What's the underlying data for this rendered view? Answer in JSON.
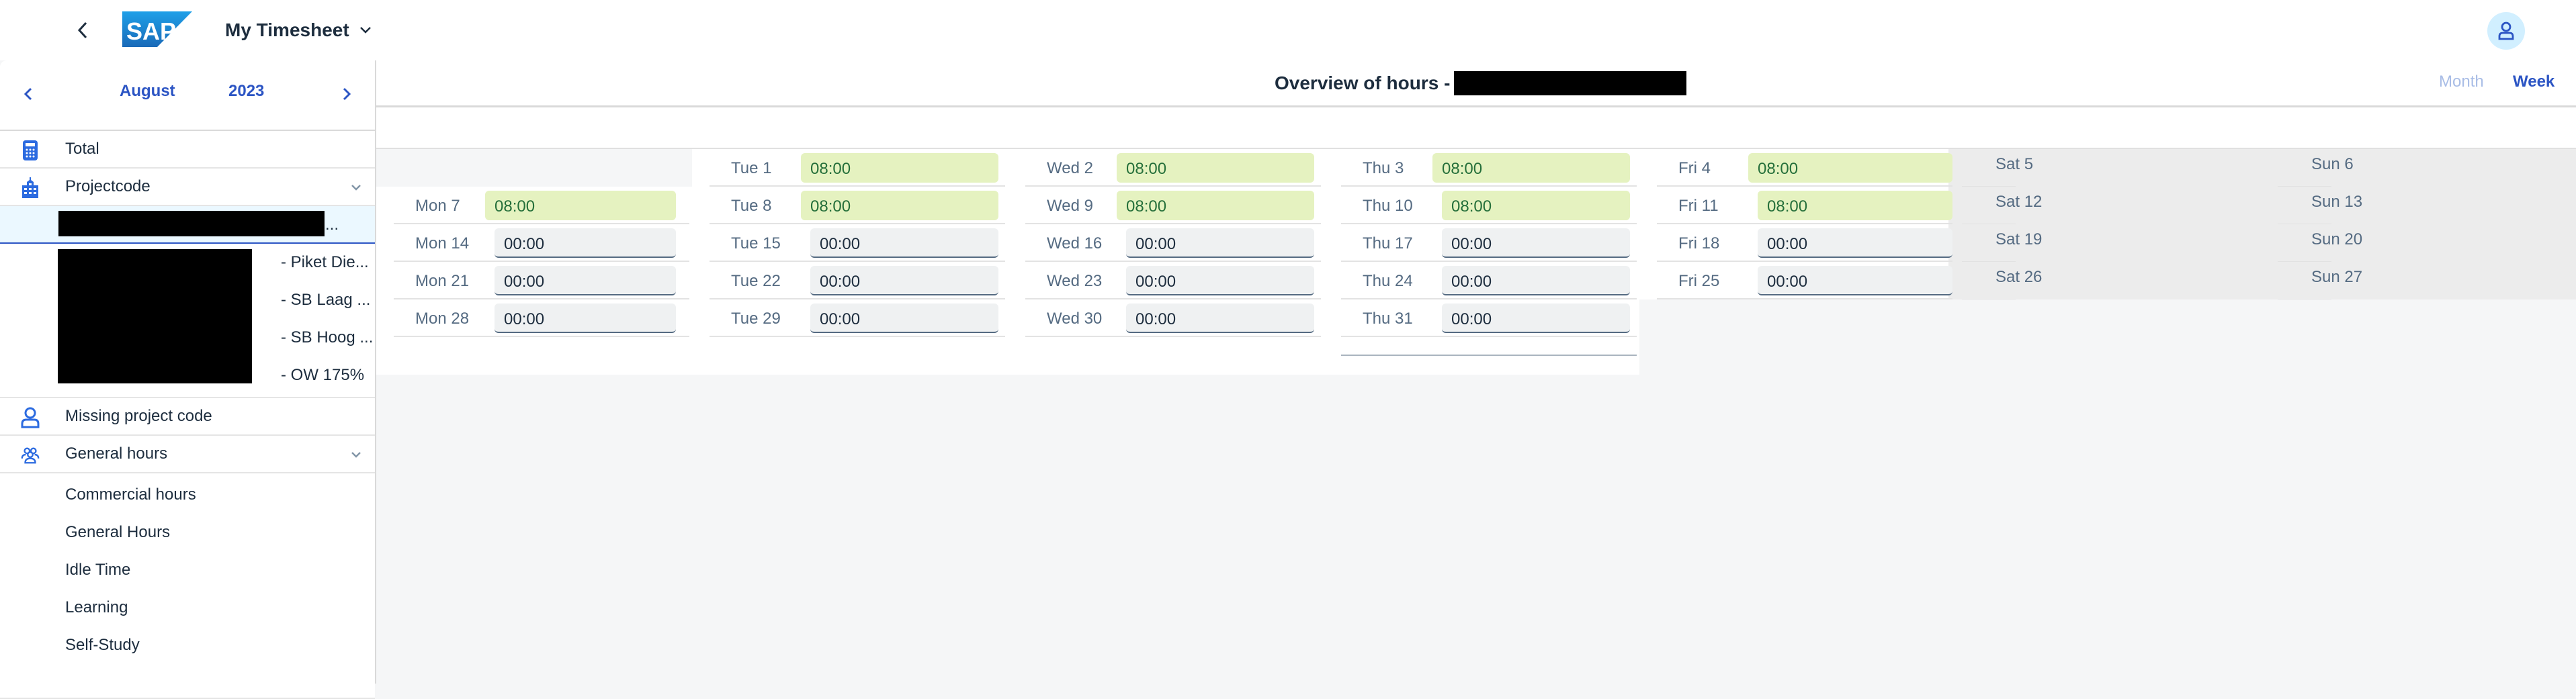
{
  "shell": {
    "title": "My Timesheet",
    "logo_text": "SAP"
  },
  "colors": {
    "accent": "#2c55c4",
    "filled_bg": "#e5f2c0",
    "filled_text": "#256f3a",
    "weekend_bg": "#ececec"
  },
  "sidebar": {
    "month": "August",
    "year": "2023",
    "items": [
      {
        "label": "Total",
        "icon": "calculator-icon"
      },
      {
        "label": "Projectcode",
        "icon": "building-icon",
        "expandable": true
      },
      {
        "label": "Missing project code",
        "icon": "person-icon"
      },
      {
        "label": "General hours",
        "icon": "group-icon",
        "expandable": true
      }
    ],
    "project_suffixes": [
      "- Piket Die...",
      "- SB Laag ...",
      "- SB Hoog ...",
      "- OW 175%"
    ],
    "selected_project_ellipsis": "...",
    "general_subitems": [
      "Commercial hours",
      "General Hours",
      "Idle Time",
      "Learning",
      "Self-Study"
    ]
  },
  "main": {
    "heading": "Overview of hours -",
    "view_month": "Month",
    "view_week": "Week",
    "weeks": [
      {
        "mon": null,
        "tue": {
          "d": "Tue 1",
          "v": "08:00"
        },
        "wed": {
          "d": "Wed 2",
          "v": "08:00"
        },
        "thu": {
          "d": "Thu 3",
          "v": "08:00"
        },
        "fri": {
          "d": "Fri 4",
          "v": "08:00"
        },
        "sat": "Sat 5",
        "sun": "Sun 6"
      },
      {
        "mon": {
          "d": "Mon 7",
          "v": "08:00"
        },
        "tue": {
          "d": "Tue 8",
          "v": "08:00"
        },
        "wed": {
          "d": "Wed 9",
          "v": "08:00"
        },
        "thu": {
          "d": "Thu 10",
          "v": "08:00"
        },
        "fri": {
          "d": "Fri 11",
          "v": "08:00"
        },
        "sat": "Sat 12",
        "sun": "Sun 13"
      },
      {
        "mon": {
          "d": "Mon 14",
          "v": "00:00"
        },
        "tue": {
          "d": "Tue 15",
          "v": "00:00"
        },
        "wed": {
          "d": "Wed 16",
          "v": "00:00"
        },
        "thu": {
          "d": "Thu 17",
          "v": "00:00"
        },
        "fri": {
          "d": "Fri 18",
          "v": "00:00"
        },
        "sat": "Sat 19",
        "sun": "Sun 20"
      },
      {
        "mon": {
          "d": "Mon 21",
          "v": "00:00"
        },
        "tue": {
          "d": "Tue 22",
          "v": "00:00"
        },
        "wed": {
          "d": "Wed 23",
          "v": "00:00"
        },
        "thu": {
          "d": "Thu 24",
          "v": "00:00"
        },
        "fri": {
          "d": "Fri 25",
          "v": "00:00"
        },
        "sat": "Sat 26",
        "sun": "Sun 27"
      },
      {
        "mon": {
          "d": "Mon 28",
          "v": "00:00"
        },
        "tue": {
          "d": "Tue 29",
          "v": "00:00"
        },
        "wed": {
          "d": "Wed 30",
          "v": "00:00"
        },
        "thu": {
          "d": "Thu 31",
          "v": "00:00"
        },
        "fri": null,
        "sat": null,
        "sun": null
      }
    ]
  }
}
